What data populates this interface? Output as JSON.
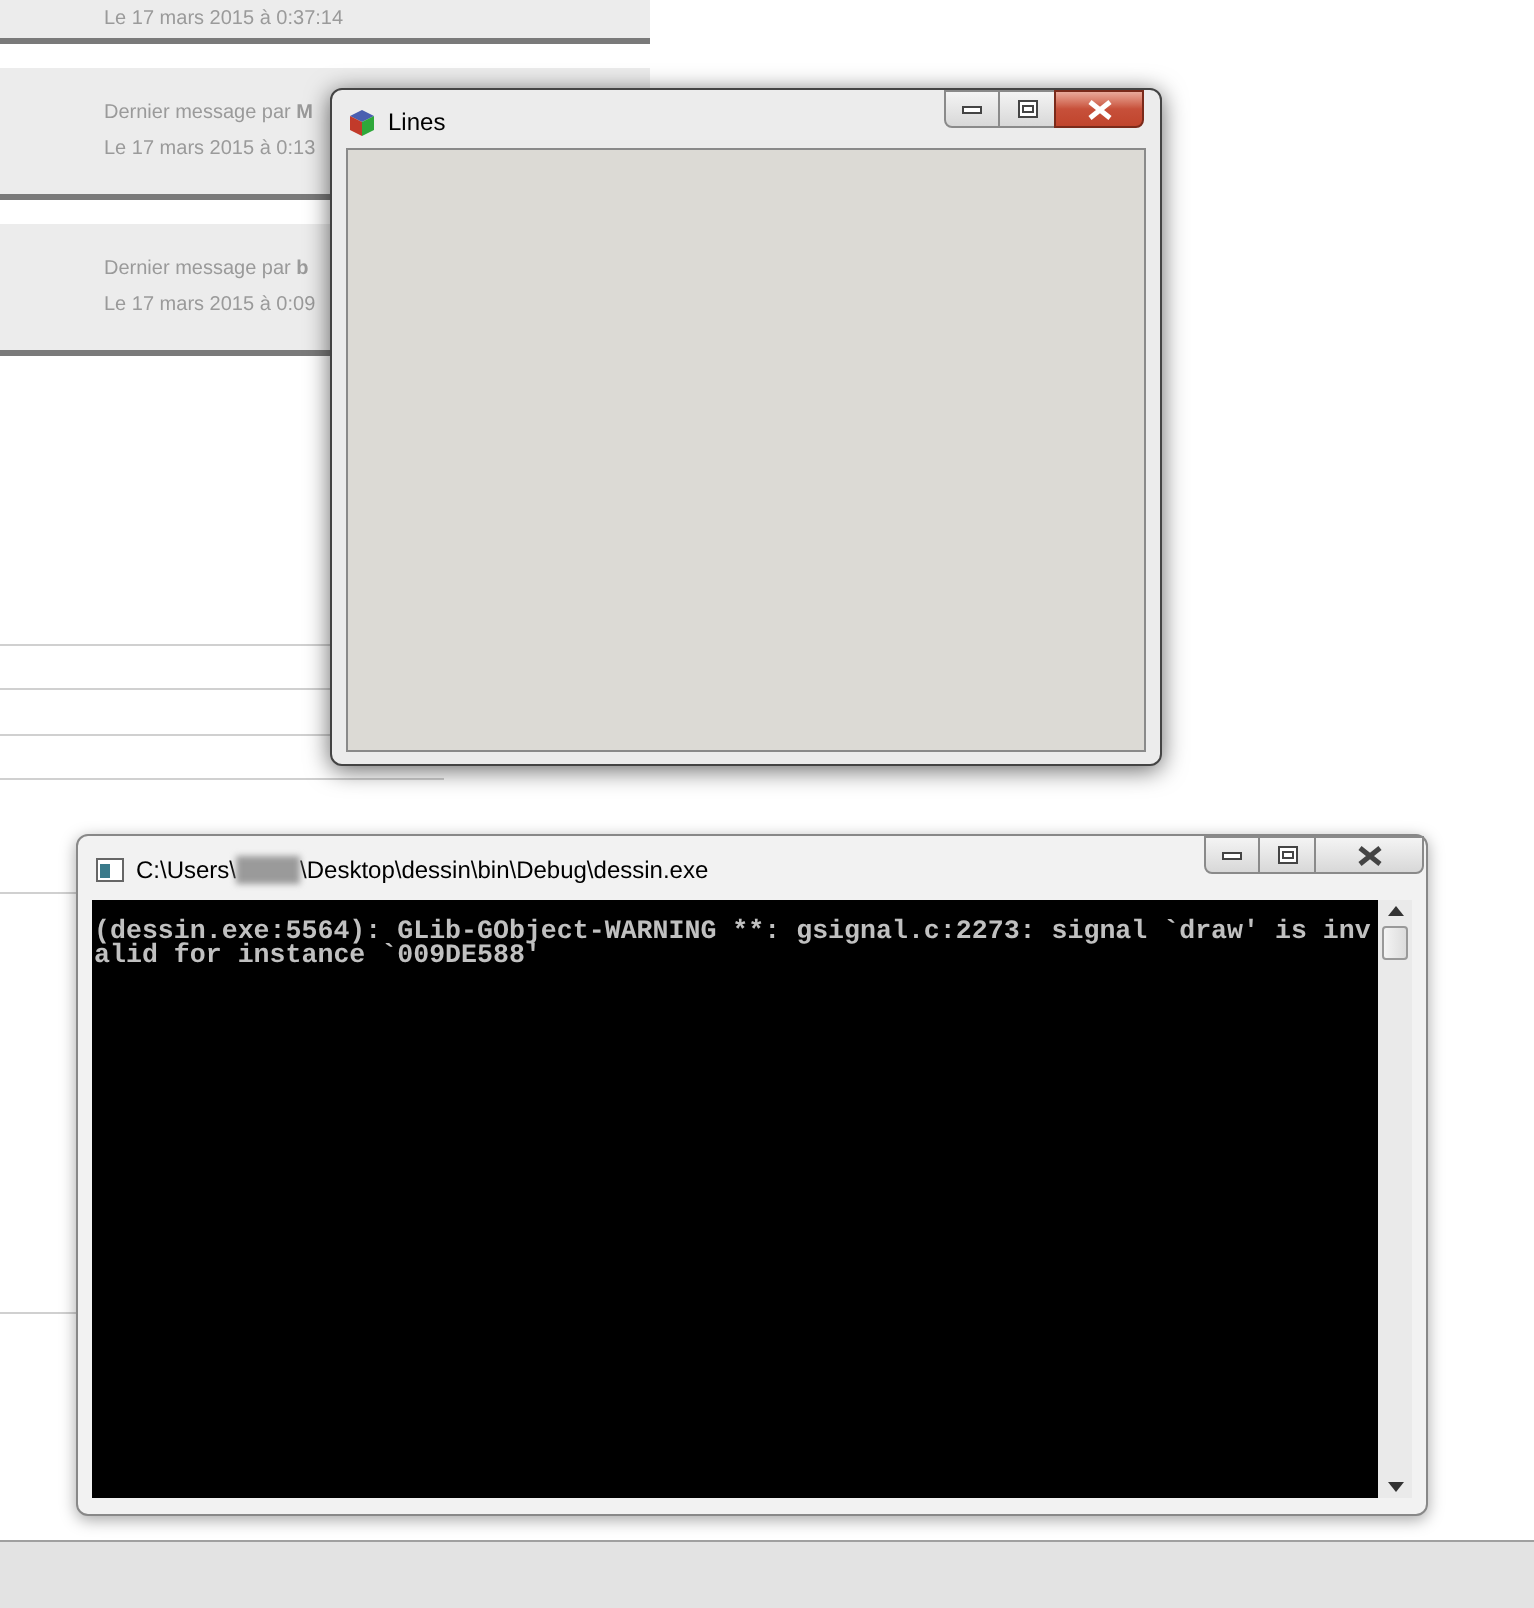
{
  "page": {
    "cards": [
      {
        "lines": [
          "Le 17 mars 2015 à 0:37:14"
        ]
      },
      {
        "lines": [
          "Dernier message par **M**",
          "Le 17 mars 2015 à 0:13"
        ]
      },
      {
        "lines": [
          "Dernier message par **b**",
          "Le 17 mars 2015 à 0:09"
        ]
      }
    ]
  },
  "lines_window": {
    "title": "Lines"
  },
  "console_window": {
    "title_start": "C:\\Users\\",
    "title_end": "\\Desktop\\dessin\\bin\\Debug\\dessin.exe",
    "output": [
      "(dessin.exe:5564): GLib-GObject-WARNING **: gsignal.c:2273: signal `draw' is inv",
      "alid for instance `009DE588'"
    ]
  }
}
